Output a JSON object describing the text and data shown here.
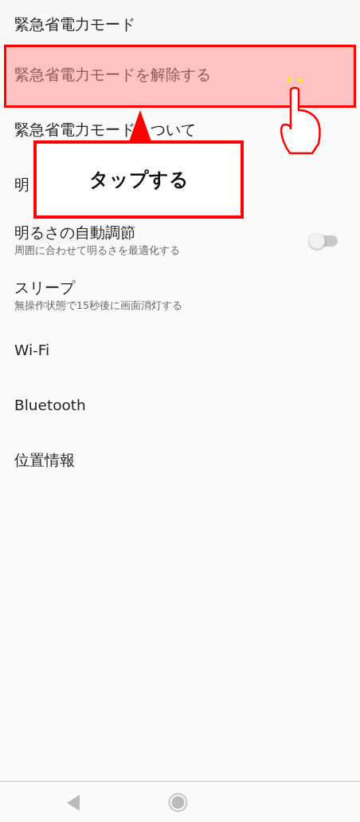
{
  "header": {
    "title": "緊急省電力モード"
  },
  "settings": [
    {
      "kind": "plain",
      "title": "緊急省電力モードを解除する",
      "highlighted": true
    },
    {
      "kind": "plain",
      "title": "緊急省電力モード",
      "title_tail": "ついて",
      "highlighted": false
    },
    {
      "kind": "plain",
      "title": "明",
      "highlighted": false
    },
    {
      "kind": "toggle",
      "title": "明るさの自動調節",
      "subtitle": "周囲に合わせて明るさを最適化する",
      "on": false,
      "highlighted": false
    },
    {
      "kind": "plain",
      "title": "スリープ",
      "subtitle": "無操作状態で15秒後に画面消灯する",
      "highlighted": false
    },
    {
      "kind": "plain",
      "title": "Wi-Fi",
      "highlighted": false
    },
    {
      "kind": "plain",
      "title": "Bluetooth",
      "highlighted": false
    },
    {
      "kind": "plain",
      "title": "位置情報",
      "highlighted": false
    }
  ],
  "callout": {
    "text": "タップする"
  }
}
